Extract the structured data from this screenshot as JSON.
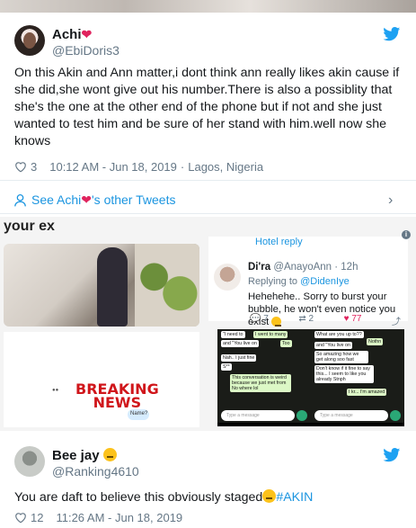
{
  "tweet1": {
    "name": "Achi",
    "handle": "@EbiDoris3",
    "text": "On this Akin and Ann matter,i dont think ann really likes akin cause if she did,she wont give out his number.There is also a possiblity that she's the one at the other end of the phone but if not and she just wanted to test him and be sure of her stand with him.well now she knows",
    "likes": "3",
    "timestamp": "10:12 AM - Jun 18, 2019",
    "location": "Lagos, Nigeria",
    "see_more_prefix": "See Achi",
    "see_more_suffix": "'s other Tweets"
  },
  "embed": {
    "top_cut_text": "your ex",
    "reply_link": "Hotel reply",
    "breaking": [
      "BREAKING",
      "NEWS"
    ],
    "name_bubble": "Name?",
    "reply": {
      "name": "Di'ra",
      "handle": "@AnayoAnn · 12h",
      "replying_prefix": "Replying to",
      "replying_to": "@DidenIye",
      "text": "Hehehehe.. Sorry to burst your bubble, he won't even notice you exist",
      "replies": "7",
      "retweets": "2",
      "likes": "77"
    },
    "whatsapp_left": {
      "messages": [
        {
          "dir": "in",
          "text": "\"I need to"
        },
        {
          "dir": "out",
          "text": "I went to many"
        },
        {
          "dir": "in",
          "text": "and \"You live on"
        },
        {
          "dir": "out",
          "text": "Too"
        },
        {
          "dir": "in",
          "text": "Nah.. I just fine"
        },
        {
          "dir": "in",
          "text": "S**"
        },
        {
          "dir": "out",
          "text": "This conversation is weird because we just met from No where lol"
        },
        {
          "dir": "in",
          "text": "Type a message"
        }
      ]
    },
    "whatsapp_right": {
      "messages": [
        {
          "dir": "in",
          "text": "What are you up to??"
        },
        {
          "dir": "out",
          "text": "Nothn"
        },
        {
          "dir": "in",
          "text": "and \"You live on"
        },
        {
          "dir": "in",
          "text": "So amazing how we get along soo fast"
        },
        {
          "dir": "in",
          "text": "Don't know if it fine to say this... I seem to like you already Stnph"
        },
        {
          "dir": "out",
          "text": "I kr... I'm amazed"
        },
        {
          "dir": "in",
          "text": "Type a message"
        }
      ]
    }
  },
  "tweet2": {
    "name": "Bee jay",
    "handle": "@Ranking4610",
    "text_prefix": "You are daft to believe this obviously staged",
    "hashtag": "#AKIN",
    "likes": "12",
    "timestamp": "11:26 AM - Jun 18, 2019"
  },
  "colors": {
    "link": "#1b95e0",
    "secondary": "#657786",
    "heart": "#e0245e"
  },
  "icons": [
    "twitter-bird-icon",
    "heart-outline-icon",
    "person-icon",
    "chevron-right-icon",
    "reply-icon",
    "retweet-icon",
    "heart-filled-icon",
    "share-icon",
    "info-icon"
  ]
}
